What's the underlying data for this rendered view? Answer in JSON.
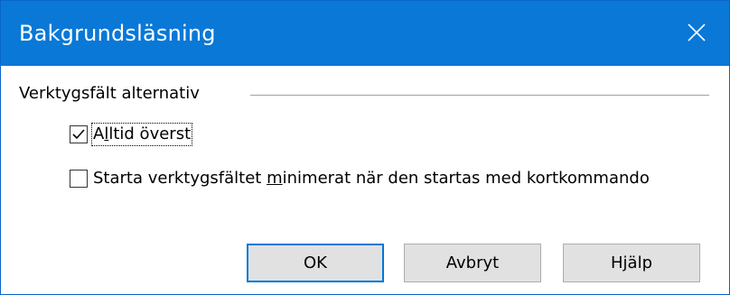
{
  "window": {
    "title": "Bakgrundsläsning"
  },
  "group": {
    "label": "Verktygsfält alternativ"
  },
  "options": [
    {
      "label_pre": "A",
      "label_underlined": "l",
      "label_post": "ltid överst",
      "checked": true
    },
    {
      "label_pre": "Starta verktygsfältet ",
      "label_underlined": "m",
      "label_post": "inimerat när den startas med kortkommando",
      "checked": false
    }
  ],
  "buttons": {
    "ok": "OK",
    "cancel": "Avbryt",
    "help": "Hjälp"
  },
  "colors": {
    "titlebar": "#0a78d7",
    "button_face": "#e1e1e1",
    "default_button_border": "#0078d7"
  },
  "icons": {
    "close": "close-icon",
    "check": "checkmark-icon"
  }
}
